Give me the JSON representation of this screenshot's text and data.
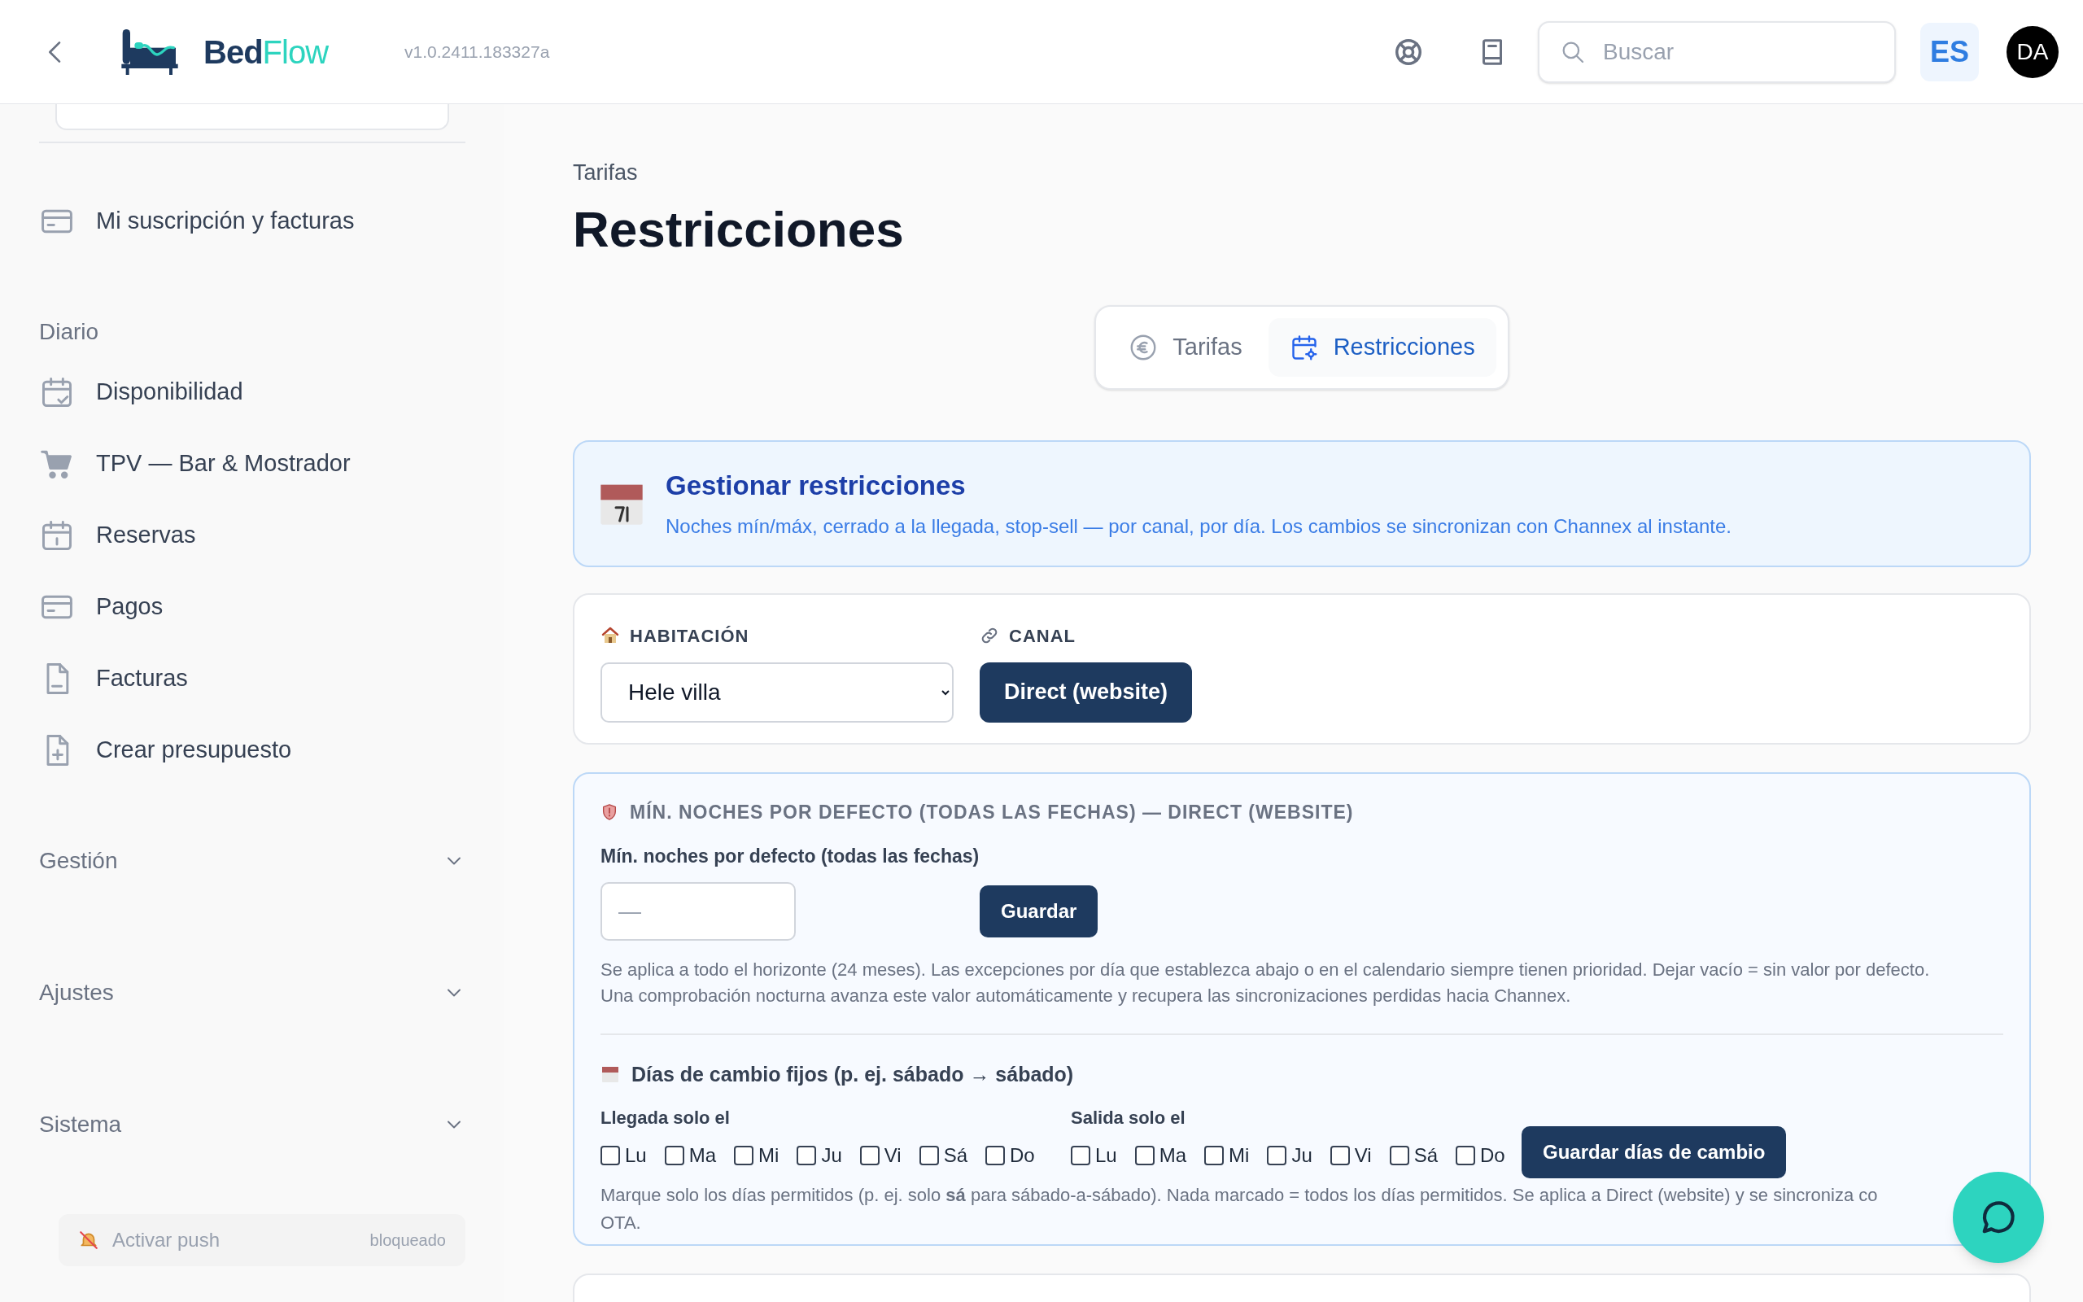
{
  "header": {
    "logo": {
      "part1": "Bed",
      "part2": "Flow"
    },
    "version": "v1.0.2411.183327a",
    "search": {
      "placeholder": "Buscar"
    },
    "language": "ES",
    "avatar": "DA"
  },
  "sidebar": {
    "top_items": [
      {
        "label": "Mi suscripción y facturas",
        "kind": "card"
      }
    ],
    "sections": [
      {
        "title": "Diario",
        "expanded": true,
        "items": [
          {
            "label": "Disponibilidad",
            "kind": "calendar-check"
          },
          {
            "label": "TPV — Bar & Mostrador",
            "kind": "cart"
          },
          {
            "label": "Reservas",
            "kind": "calendar"
          },
          {
            "label": "Pagos",
            "kind": "card"
          },
          {
            "label": "Facturas",
            "kind": "file"
          },
          {
            "label": "Crear presupuesto",
            "kind": "file-plus"
          }
        ]
      },
      {
        "title": "Gestión",
        "expanded": false
      },
      {
        "title": "Ajustes",
        "expanded": false
      },
      {
        "title": "Sistema",
        "expanded": false
      }
    ],
    "push": {
      "label": "Activar push",
      "status": "bloqueado"
    }
  },
  "breadcrumb": "Tarifas",
  "title": "Restricciones",
  "tabs": [
    {
      "label": "Tarifas",
      "kind": "euro",
      "selected": false
    },
    {
      "label": "Restricciones",
      "kind": "calendar-gear",
      "selected": true
    }
  ],
  "banner": {
    "title": "Gestionar restricciones",
    "text": "Noches mín/máx, cerrado a la llegada, stop-sell — por canal, por día. Los cambios se sincronizan con Channex al instante."
  },
  "selectors": {
    "room": {
      "label": "HABITACIÓN",
      "value": "Hele villa"
    },
    "channel": {
      "label": "CANAL",
      "channels": [
        {
          "label": "Direct (website)",
          "selected": true
        }
      ]
    }
  },
  "min_nights": {
    "heading": "MÍN. NOCHES POR DEFECTO (TODAS LAS FECHAS) — DIRECT (WEBSITE)",
    "field_label": "Mín. noches por defecto (todas las fechas)",
    "placeholder": "—",
    "button": "Guardar",
    "help": "Se aplica a todo el horizonte (24 meses). Las excepciones por día que establezca abajo o en el calendario siempre tienen prioridad. Dejar vacío = sin valor por defecto. Una comprobación nocturna avanza este valor automáticamente y recupera las sincronizaciones perdidas hacia Channex."
  },
  "changeover": {
    "title": "Días de cambio fijos (p. ej. sábado → sábado)",
    "groups": [
      {
        "label": "Llegada solo el",
        "days": [
          {
            "label": "Lu",
            "checked": false
          },
          {
            "label": "Ma",
            "checked": false
          },
          {
            "label": "Mi",
            "checked": false
          },
          {
            "label": "Ju",
            "checked": false
          },
          {
            "label": "Vi",
            "checked": false
          },
          {
            "label": "Sá",
            "checked": false
          },
          {
            "label": "Do",
            "checked": false
          }
        ]
      },
      {
        "label": "Salida solo el",
        "days": [
          {
            "label": "Lu",
            "checked": false
          },
          {
            "label": "Ma",
            "checked": false
          },
          {
            "label": "Mi",
            "checked": false
          },
          {
            "label": "Ju",
            "checked": false
          },
          {
            "label": "Vi",
            "checked": false
          },
          {
            "label": "Sá",
            "checked": false
          },
          {
            "label": "Do",
            "checked": false
          }
        ]
      }
    ],
    "button": "Guardar días de cambio",
    "hint": [
      "Marque solo los días permitidos (p. ej. solo **sá** para sábado-a-sábado). Nada marcado = todos los días permitidos. Se aplica a Direct (website) y se sincroniza co",
      "OTA."
    ]
  }
}
